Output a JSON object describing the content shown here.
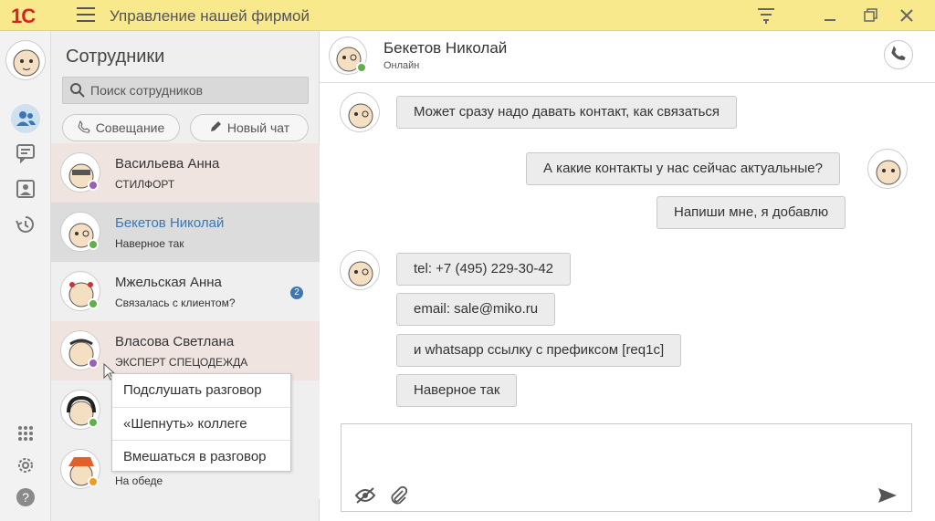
{
  "app": {
    "logo": "1С",
    "title": "Управление нашей фирмой",
    "icons": [
      "menu-icon",
      "filter-icon",
      "minimize-icon",
      "restore-icon",
      "close-icon"
    ]
  },
  "rail": {
    "icons": [
      "people-icon",
      "chat-icon",
      "contact-card-icon",
      "history-icon",
      "dialpad-icon",
      "gear-icon",
      "help-icon"
    ]
  },
  "contacts": {
    "title": "Сотрудники",
    "search_placeholder": "Поиск сотрудников",
    "meeting_label": "Совещание",
    "new_chat_label": "Новый чат",
    "items": [
      {
        "name": "Васильева Анна",
        "sub": "СТИЛФОРТ",
        "status_color": "#9b5fb5",
        "bg": "#f0e4e0"
      },
      {
        "name": "Бекетов Николай",
        "sub": "Наверное так",
        "status_color": "#5fb04b",
        "bg": "#dcdcdc",
        "name_color": "#3a78b5"
      },
      {
        "name": "Мжельская Анна",
        "sub": "Связалась с клиентом?",
        "status_color": "#5fb04b",
        "bg": "#efefef",
        "badge": "2"
      },
      {
        "name": "Власова Светлана",
        "sub": "ЭКСПЕРТ СПЕЦОДЕЖДА",
        "status_color": "#9b5fb5",
        "bg": "#f0e4e0"
      },
      {
        "name": "",
        "sub": "",
        "status_color": "#5fb04b",
        "bg": "#efefef"
      },
      {
        "name": "",
        "sub": "На обеде",
        "status_color": "#f39a1e",
        "bg": "#efefef"
      }
    ]
  },
  "context_menu": {
    "items": [
      "Подслушать разговор",
      "«Шепнуть» коллеге",
      "Вмешаться в разговор"
    ]
  },
  "chat": {
    "name": "Бекетов Николай",
    "status": "Онлайн",
    "messages": [
      {
        "text": "Может сразу надо давать контакт, как связаться",
        "side": "left"
      },
      {
        "text": "А какие контакты у нас сейчас актуальные?",
        "side": "right"
      },
      {
        "text": "Напиши мне, я добавлю",
        "side": "right"
      },
      {
        "text": "tel: +7 (495) 229-30-42",
        "side": "left"
      },
      {
        "text": "email: sale@miko.ru",
        "side": "left"
      },
      {
        "text": "и whatsapp ссылку с префиксом [req1c]",
        "side": "left"
      },
      {
        "text": "Наверное так",
        "side": "left"
      }
    ]
  },
  "composer": {
    "value": "",
    "icons": [
      "hidden-eye-icon",
      "paperclip-icon",
      "send-icon"
    ]
  }
}
